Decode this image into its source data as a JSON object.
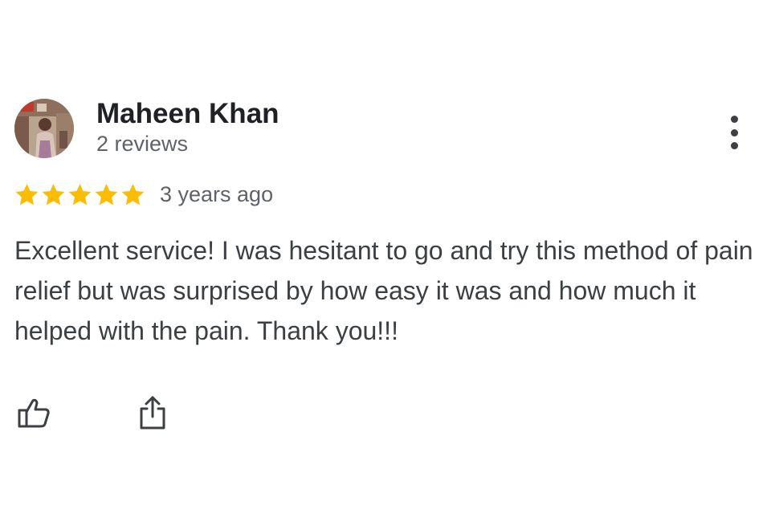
{
  "review": {
    "author_name": "Maheen Khan",
    "author_reviews": "2 reviews",
    "rating": 5,
    "max_rating": 5,
    "time_ago": "3 years ago",
    "text": "Excellent service! I was hesitant to go and try this method of pain relief but was surprised by how easy it was and how much it helped with the pain. Thank you!!!"
  },
  "icons": {
    "more": "more-vert-icon",
    "star": "star-icon",
    "like": "thumbs-up-icon",
    "share": "share-icon"
  },
  "colors": {
    "star": "#FBBC04",
    "name": "#202124",
    "secondary_text": "#5f6368",
    "body_text": "#3c4043",
    "icon": "#3c4043"
  }
}
